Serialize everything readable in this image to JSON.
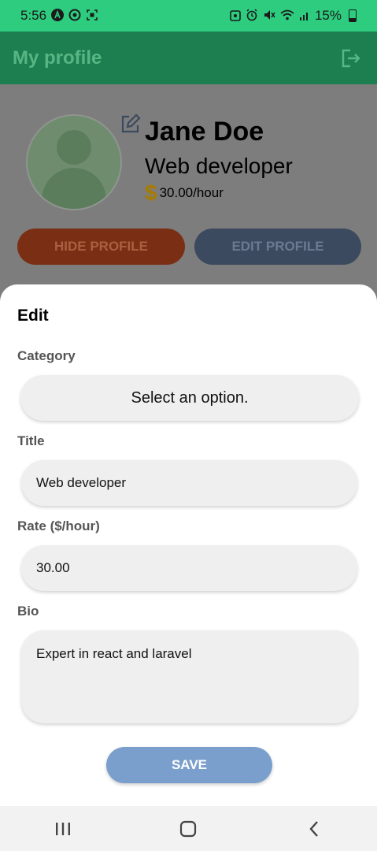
{
  "status_bar": {
    "time": "5:56",
    "battery": "15%",
    "icons": [
      "a-badge-icon",
      "sync-icon",
      "screenshot-icon",
      "alarm-lock-icon",
      "alarm-icon",
      "mute-icon",
      "wifi-icon",
      "signal-icon",
      "battery-icon"
    ]
  },
  "app_bar": {
    "title": "My profile",
    "logout_icon": "logout-icon"
  },
  "profile": {
    "name": "Jane Doe",
    "job_title": "Web developer",
    "rate": "30.00/hour",
    "dollar_symbol": "$",
    "hide_button": "HIDE PROFILE",
    "edit_button": "EDIT PROFILE"
  },
  "edit_sheet": {
    "title": "Edit",
    "category_label": "Category",
    "category_value": "Select an option.",
    "title_label": "Title",
    "title_value": "Web developer",
    "rate_label": "Rate ($/hour)",
    "rate_value": "30.00",
    "bio_label": "Bio",
    "bio_value": "Expert in react and laravel",
    "save_button": "SAVE"
  },
  "nav_bar": {
    "recents_icon": "recents-icon",
    "home_icon": "home-icon",
    "back_icon": "back-icon"
  },
  "colors": {
    "status_bar": "#2ecc7f",
    "app_bar_dimmed": "#1d7e50",
    "save_button": "#7b9fcc",
    "field_bg": "#efefef"
  }
}
